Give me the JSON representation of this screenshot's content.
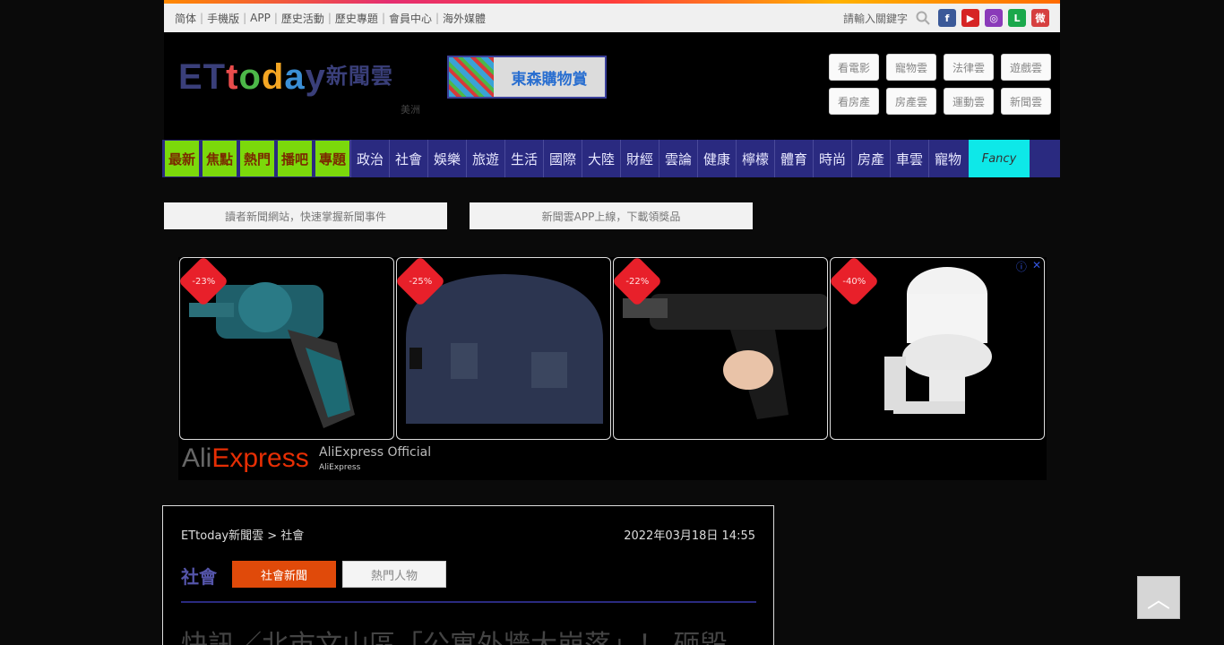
{
  "topbar": {
    "links": [
      "简体",
      "手機版",
      "APP",
      "歷史活動",
      "歷史專題",
      "會員中心",
      "海外媒體"
    ],
    "search_label": "請輸入關鍵字",
    "social": [
      {
        "name": "facebook-icon",
        "glyph": "f",
        "color": "#3b5998"
      },
      {
        "name": "youtube-icon",
        "glyph": "▶",
        "color": "#d62424"
      },
      {
        "name": "instagram-icon",
        "glyph": "◎",
        "color": "#8a3ab9"
      },
      {
        "name": "line-icon",
        "glyph": "L",
        "color": "#1aa84b"
      },
      {
        "name": "weibo-icon",
        "glyph": "微",
        "color": "#d64040"
      }
    ]
  },
  "header": {
    "logo": {
      "et": "ET",
      "t": "t",
      "o": "o",
      "d": "d",
      "a": "a",
      "y": "y",
      "cn": "新聞雲"
    },
    "region": "美洲",
    "banner_text": "東森購物賞",
    "quick_buttons": [
      "看電影",
      "寵物雲",
      "法律雲",
      "遊戲雲",
      "看房產",
      "房產雲",
      "運動雲",
      "新聞雲"
    ]
  },
  "nav": {
    "hot_items": [
      "最新",
      "焦點",
      "熱門",
      "播吧",
      "專題"
    ],
    "items": [
      "政治",
      "社會",
      "娛樂",
      "旅遊",
      "生活",
      "國際",
      "大陸",
      "財經",
      "雲論",
      "健康",
      "檸檬",
      "體育",
      "時尚",
      "房產",
      "車雲",
      "寵物"
    ],
    "special": "Fancy"
  },
  "infobars": [
    "讀者新聞網站，快速掌握新聞事件",
    "新聞雲APP上線，下載領獎品"
  ],
  "ad": {
    "discounts": [
      "-23%",
      "-25%",
      "-22%",
      "-40%"
    ],
    "brand": "AliExpress",
    "brand_ali": "Ali",
    "brand_express": "Express",
    "official": "AliExpress Official",
    "sub": "AliExpress",
    "info_icon": "ⓘ",
    "close_icon": "✕"
  },
  "article": {
    "breadcrumb": "ETtoday新聞雲 > 社會",
    "date": "2022年03月18日 14:55",
    "category": "社會",
    "btn_primary": "社會新聞",
    "btn_secondary": "熱門人物",
    "headline": "快訊／北市文山區「公寓外牆大崩落」！ 砸毀"
  },
  "back_to_top": "︿"
}
